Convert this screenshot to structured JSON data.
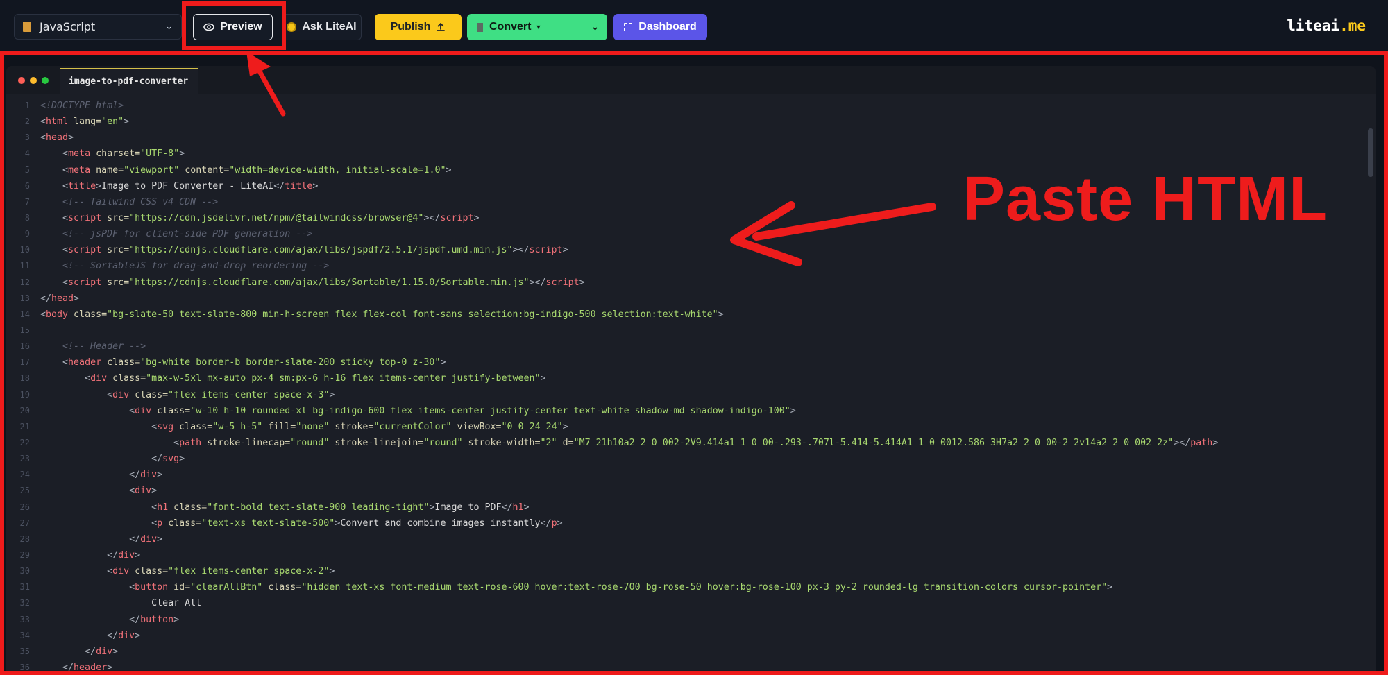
{
  "toolbar": {
    "language": "JavaScript",
    "preview": "Preview",
    "ask": "Ask LiteAI",
    "publish": "Publish",
    "convert": "Convert",
    "dashboard": "Dashboard"
  },
  "brand": {
    "name": "liteai",
    "suffix": ".me"
  },
  "editor": {
    "tab_title": "image-to-pdf-converter"
  },
  "annotation": {
    "label": "Paste HTML"
  },
  "colors": {
    "highlight": "#ef1b1b",
    "publish": "#fbc91b",
    "convert": "#3fdf84",
    "dashboard": "#5b55e8"
  },
  "code_lines": [
    [
      [
        "c",
        "<!DOCTYPE html>"
      ]
    ],
    [
      [
        "p",
        "<"
      ],
      [
        "t",
        "html"
      ],
      [
        "a",
        " lang="
      ],
      [
        "v",
        "\"en\""
      ],
      [
        "p",
        ">"
      ]
    ],
    [
      [
        "p",
        "<"
      ],
      [
        "t",
        "head"
      ],
      [
        "p",
        ">"
      ]
    ],
    [
      [
        "x",
        "    "
      ],
      [
        "p",
        "<"
      ],
      [
        "t",
        "meta"
      ],
      [
        "a",
        " charset="
      ],
      [
        "v",
        "\"UTF-8\""
      ],
      [
        "p",
        ">"
      ]
    ],
    [
      [
        "x",
        "    "
      ],
      [
        "p",
        "<"
      ],
      [
        "t",
        "meta"
      ],
      [
        "a",
        " name="
      ],
      [
        "v",
        "\"viewport\""
      ],
      [
        "a",
        " content="
      ],
      [
        "v",
        "\"width=device-width, initial-scale=1.0\""
      ],
      [
        "p",
        ">"
      ]
    ],
    [
      [
        "x",
        "    "
      ],
      [
        "p",
        "<"
      ],
      [
        "t",
        "title"
      ],
      [
        "p",
        ">"
      ],
      [
        "x",
        "Image to PDF Converter - LiteAI"
      ],
      [
        "p",
        "</"
      ],
      [
        "t",
        "title"
      ],
      [
        "p",
        ">"
      ]
    ],
    [
      [
        "x",
        "    "
      ],
      [
        "c",
        "<!-- Tailwind CSS v4 CDN -->"
      ]
    ],
    [
      [
        "x",
        "    "
      ],
      [
        "p",
        "<"
      ],
      [
        "t",
        "script"
      ],
      [
        "a",
        " src="
      ],
      [
        "v",
        "\"https://cdn.jsdelivr.net/npm/@tailwindcss/browser@4\""
      ],
      [
        "p",
        "></"
      ],
      [
        "t",
        "script"
      ],
      [
        "p",
        ">"
      ]
    ],
    [
      [
        "x",
        "    "
      ],
      [
        "c",
        "<!-- jsPDF for client-side PDF generation -->"
      ]
    ],
    [
      [
        "x",
        "    "
      ],
      [
        "p",
        "<"
      ],
      [
        "t",
        "script"
      ],
      [
        "a",
        " src="
      ],
      [
        "v",
        "\"https://cdnjs.cloudflare.com/ajax/libs/jspdf/2.5.1/jspdf.umd.min.js\""
      ],
      [
        "p",
        "></"
      ],
      [
        "t",
        "script"
      ],
      [
        "p",
        ">"
      ]
    ],
    [
      [
        "x",
        "    "
      ],
      [
        "c",
        "<!-- SortableJS for drag-and-drop reordering -->"
      ]
    ],
    [
      [
        "x",
        "    "
      ],
      [
        "p",
        "<"
      ],
      [
        "t",
        "script"
      ],
      [
        "a",
        " src="
      ],
      [
        "v",
        "\"https://cdnjs.cloudflare.com/ajax/libs/Sortable/1.15.0/Sortable.min.js\""
      ],
      [
        "p",
        "></"
      ],
      [
        "t",
        "script"
      ],
      [
        "p",
        ">"
      ]
    ],
    [
      [
        "p",
        "</"
      ],
      [
        "t",
        "head"
      ],
      [
        "p",
        ">"
      ]
    ],
    [
      [
        "p",
        "<"
      ],
      [
        "t",
        "body"
      ],
      [
        "a",
        " class="
      ],
      [
        "v",
        "\"bg-slate-50 text-slate-800 min-h-screen flex flex-col font-sans selection:bg-indigo-500 selection:text-white\""
      ],
      [
        "p",
        ">"
      ]
    ],
    [],
    [
      [
        "x",
        "    "
      ],
      [
        "c",
        "<!-- Header -->"
      ]
    ],
    [
      [
        "x",
        "    "
      ],
      [
        "p",
        "<"
      ],
      [
        "t",
        "header"
      ],
      [
        "a",
        " class="
      ],
      [
        "v",
        "\"bg-white border-b border-slate-200 sticky top-0 z-30\""
      ],
      [
        "p",
        ">"
      ]
    ],
    [
      [
        "x",
        "        "
      ],
      [
        "p",
        "<"
      ],
      [
        "t",
        "div"
      ],
      [
        "a",
        " class="
      ],
      [
        "v",
        "\"max-w-5xl mx-auto px-4 sm:px-6 h-16 flex items-center justify-between\""
      ],
      [
        "p",
        ">"
      ]
    ],
    [
      [
        "x",
        "            "
      ],
      [
        "p",
        "<"
      ],
      [
        "t",
        "div"
      ],
      [
        "a",
        " class="
      ],
      [
        "v",
        "\"flex items-center space-x-3\""
      ],
      [
        "p",
        ">"
      ]
    ],
    [
      [
        "x",
        "                "
      ],
      [
        "p",
        "<"
      ],
      [
        "t",
        "div"
      ],
      [
        "a",
        " class="
      ],
      [
        "v",
        "\"w-10 h-10 rounded-xl bg-indigo-600 flex items-center justify-center text-white shadow-md shadow-indigo-100\""
      ],
      [
        "p",
        ">"
      ]
    ],
    [
      [
        "x",
        "                    "
      ],
      [
        "p",
        "<"
      ],
      [
        "t",
        "svg"
      ],
      [
        "a",
        " class="
      ],
      [
        "v",
        "\"w-5 h-5\""
      ],
      [
        "a",
        " fill="
      ],
      [
        "v",
        "\"none\""
      ],
      [
        "a",
        " stroke="
      ],
      [
        "v",
        "\"currentColor\""
      ],
      [
        "a",
        " viewBox="
      ],
      [
        "v",
        "\"0 0 24 24\""
      ],
      [
        "p",
        ">"
      ]
    ],
    [
      [
        "x",
        "                        "
      ],
      [
        "p",
        "<"
      ],
      [
        "t",
        "path"
      ],
      [
        "a",
        " stroke-linecap="
      ],
      [
        "v",
        "\"round\""
      ],
      [
        "a",
        " stroke-linejoin="
      ],
      [
        "v",
        "\"round\""
      ],
      [
        "a",
        " stroke-width="
      ],
      [
        "v",
        "\"2\""
      ],
      [
        "a",
        " d="
      ],
      [
        "v",
        "\"M7 21h10a2 2 0 002-2V9.414a1 1 0 00-.293-.707l-5.414-5.414A1 1 0 0012.586 3H7a2 2 0 00-2 2v14a2 2 0 002 2z\""
      ],
      [
        "p",
        "></"
      ],
      [
        "t",
        "path"
      ],
      [
        "p",
        ">"
      ]
    ],
    [
      [
        "x",
        "                    "
      ],
      [
        "p",
        "</"
      ],
      [
        "t",
        "svg"
      ],
      [
        "p",
        ">"
      ]
    ],
    [
      [
        "x",
        "                "
      ],
      [
        "p",
        "</"
      ],
      [
        "t",
        "div"
      ],
      [
        "p",
        ">"
      ]
    ],
    [
      [
        "x",
        "                "
      ],
      [
        "p",
        "<"
      ],
      [
        "t",
        "div"
      ],
      [
        "p",
        ">"
      ]
    ],
    [
      [
        "x",
        "                    "
      ],
      [
        "p",
        "<"
      ],
      [
        "t",
        "h1"
      ],
      [
        "a",
        " class="
      ],
      [
        "v",
        "\"font-bold text-slate-900 leading-tight\""
      ],
      [
        "p",
        ">"
      ],
      [
        "x",
        "Image to PDF"
      ],
      [
        "p",
        "</"
      ],
      [
        "t",
        "h1"
      ],
      [
        "p",
        ">"
      ]
    ],
    [
      [
        "x",
        "                    "
      ],
      [
        "p",
        "<"
      ],
      [
        "t",
        "p"
      ],
      [
        "a",
        " class="
      ],
      [
        "v",
        "\"text-xs text-slate-500\""
      ],
      [
        "p",
        ">"
      ],
      [
        "x",
        "Convert and combine images instantly"
      ],
      [
        "p",
        "</"
      ],
      [
        "t",
        "p"
      ],
      [
        "p",
        ">"
      ]
    ],
    [
      [
        "x",
        "                "
      ],
      [
        "p",
        "</"
      ],
      [
        "t",
        "div"
      ],
      [
        "p",
        ">"
      ]
    ],
    [
      [
        "x",
        "            "
      ],
      [
        "p",
        "</"
      ],
      [
        "t",
        "div"
      ],
      [
        "p",
        ">"
      ]
    ],
    [
      [
        "x",
        "            "
      ],
      [
        "p",
        "<"
      ],
      [
        "t",
        "div"
      ],
      [
        "a",
        " class="
      ],
      [
        "v",
        "\"flex items-center space-x-2\""
      ],
      [
        "p",
        ">"
      ]
    ],
    [
      [
        "x",
        "                "
      ],
      [
        "p",
        "<"
      ],
      [
        "t",
        "button"
      ],
      [
        "a",
        " id="
      ],
      [
        "v",
        "\"clearAllBtn\""
      ],
      [
        "a",
        " class="
      ],
      [
        "v",
        "\"hidden text-xs font-medium text-rose-600 hover:text-rose-700 bg-rose-50 hover:bg-rose-100 px-3 py-2 rounded-lg transition-colors cursor-pointer\""
      ],
      [
        "p",
        ">"
      ]
    ],
    [
      [
        "x",
        "                    Clear All"
      ]
    ],
    [
      [
        "x",
        "                "
      ],
      [
        "p",
        "</"
      ],
      [
        "t",
        "button"
      ],
      [
        "p",
        ">"
      ]
    ],
    [
      [
        "x",
        "            "
      ],
      [
        "p",
        "</"
      ],
      [
        "t",
        "div"
      ],
      [
        "p",
        ">"
      ]
    ],
    [
      [
        "x",
        "        "
      ],
      [
        "p",
        "</"
      ],
      [
        "t",
        "div"
      ],
      [
        "p",
        ">"
      ]
    ],
    [
      [
        "x",
        "    "
      ],
      [
        "p",
        "</"
      ],
      [
        "t",
        "header"
      ],
      [
        "p",
        ">"
      ]
    ]
  ]
}
